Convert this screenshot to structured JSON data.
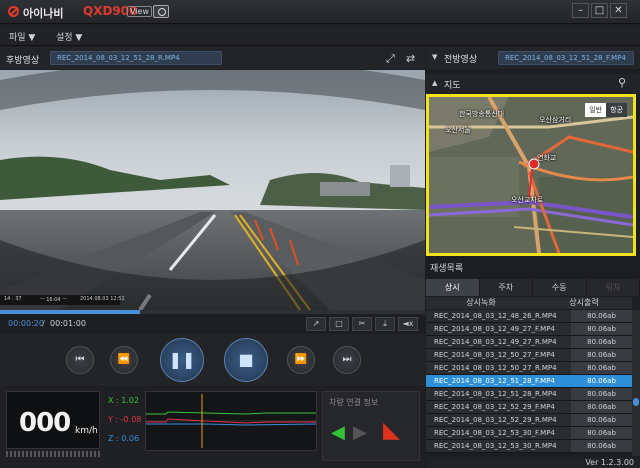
{
  "titlebar": {
    "brand": "아이나비",
    "model": "QXD900",
    "view_tag": "View",
    "buttons": [
      "–",
      "□",
      "✕"
    ]
  },
  "menu": [
    {
      "label": "파일 ▼"
    },
    {
      "label": "설정 ▼"
    }
  ],
  "rear_video": {
    "label": "후방영상",
    "file": "REC_2014_08_03_12_51_28_R.MP4"
  },
  "playback": {
    "current": "00:00:20",
    "separator": "/",
    "total": "00:01:00",
    "progress_fraction": 0.33
  },
  "dashcam_overlay": {
    "left": "14 : 37",
    "middle": "ㅡ 16:04 ㅡ",
    "right": "2014.08.03 12:51"
  },
  "tools": [
    "↗",
    "□",
    "✂",
    "⤓",
    "◄x"
  ],
  "controls": {
    "prev": "⏮",
    "rewind": "⏪",
    "pause": "❚❚",
    "stop": "■",
    "forward": "⏩",
    "next": "⏭"
  },
  "speed": {
    "value": "000",
    "unit": "km/h"
  },
  "gsensor": {
    "x": "X : 1.02",
    "y": "Y : -0.08",
    "z": "Z : 0.06",
    "colors": {
      "x": "#3cc23c",
      "y": "#e0314a",
      "z": "#3a8ee0"
    }
  },
  "vehicle": {
    "title": "차량 연결 정보"
  },
  "front_video": {
    "label": "전방영상",
    "file": "REC_2014_08_03_12_51_28_F.MP4"
  },
  "map": {
    "title": "지도",
    "mode_normal": "일반",
    "mode_satellite": "항공",
    "labels": [
      {
        "text": "한국방송통신대"
      },
      {
        "text": "오산삼거리"
      },
      {
        "text": "오산서울"
      },
      {
        "text": "연화교"
      },
      {
        "text": "오산교차로"
      }
    ]
  },
  "list": {
    "title": "재생목록",
    "tabs": [
      {
        "label": "상시",
        "active": true
      },
      {
        "label": "주차",
        "active": false
      },
      {
        "label": "수동",
        "active": false
      },
      {
        "label": "위치",
        "active": false
      }
    ],
    "columns": [
      "상시녹화",
      "상시출력"
    ],
    "rows": [
      {
        "name": "REC_2014_08_03_12_48_26_R.MP4",
        "size": "80.06ab",
        "selected": false
      },
      {
        "name": "REC_2014_08_03_12_49_27_F.MP4",
        "size": "80.06ab",
        "selected": false
      },
      {
        "name": "REC_2014_08_03_12_49_27_R.MP4",
        "size": "80.06ab",
        "selected": false
      },
      {
        "name": "REC_2014_08_03_12_50_27_F.MP4",
        "size": "80.06ab",
        "selected": false
      },
      {
        "name": "REC_2014_08_03_12_50_27_R.MP4",
        "size": "80.06ab",
        "selected": false
      },
      {
        "name": "REC_2014_08_03_12_51_28_F.MP4",
        "size": "80.06ab",
        "selected": true
      },
      {
        "name": "REC_2014_08_03_12_51_28_R.MP4",
        "size": "80.06ab",
        "selected": false
      },
      {
        "name": "REC_2014_08_03_12_52_29_F.MP4",
        "size": "80.06ab",
        "selected": false
      },
      {
        "name": "REC_2014_08_03_12_52_29_R.MP4",
        "size": "80.06ab",
        "selected": false
      },
      {
        "name": "REC_2014_08_03_12_53_30_F.MP4",
        "size": "80.06ab",
        "selected": false
      },
      {
        "name": "REC_2014_08_03_12_53_30_R.MP4",
        "size": "80.06ab",
        "selected": false
      }
    ]
  },
  "version": "Ver 1.2.3.00"
}
